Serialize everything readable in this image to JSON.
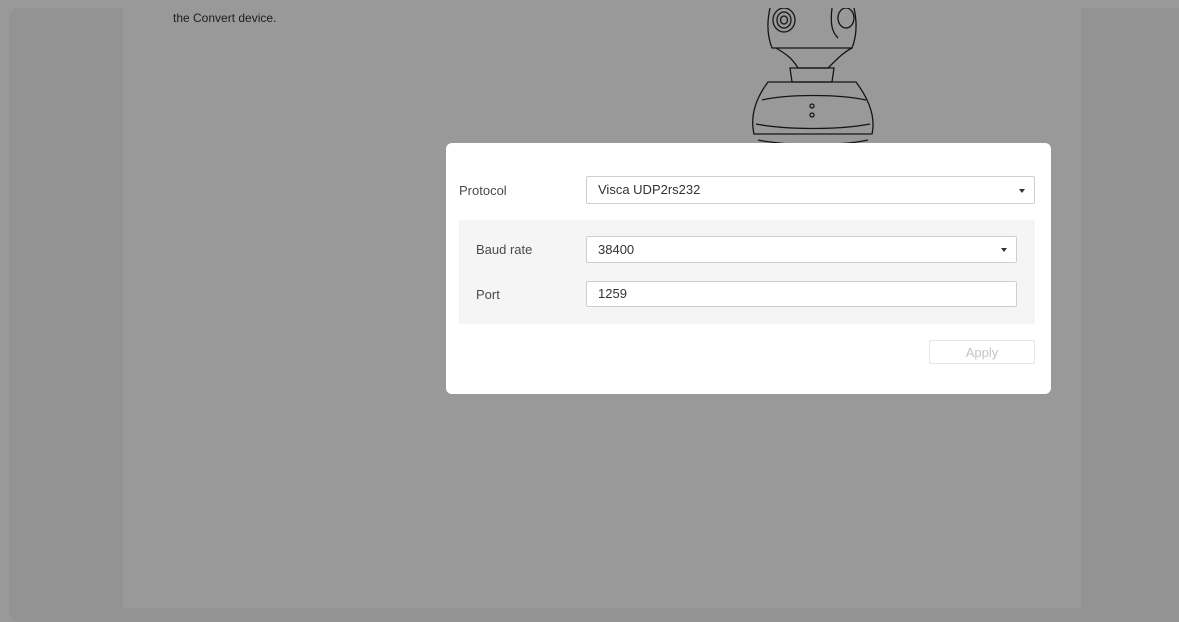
{
  "background": {
    "instruction_text": "the Convert device."
  },
  "dialog": {
    "protocol": {
      "label": "Protocol",
      "value": "Visca UDP2rs232"
    },
    "baud_rate": {
      "label": "Baud rate",
      "value": "38400"
    },
    "port": {
      "label": "Port",
      "value": "1259"
    },
    "apply_label": "Apply"
  },
  "colors": {
    "overlay": "#000000",
    "panel": "#ffffff",
    "sub_panel": "#f5f5f5",
    "disabled_text": "#c4c4c4"
  }
}
